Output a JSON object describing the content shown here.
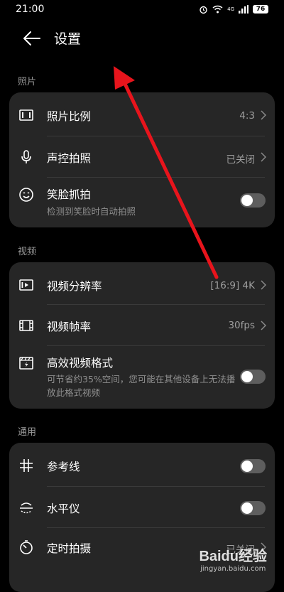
{
  "status_bar": {
    "time": "21:00",
    "battery": "76",
    "signal_tag": "4G"
  },
  "header": {
    "title": "设置"
  },
  "sections": {
    "photo": {
      "label": "照片",
      "items": [
        {
          "title": "照片比例",
          "value": "4:3"
        },
        {
          "title": "声控拍照",
          "value": "已关闭"
        },
        {
          "title": "笑脸抓拍",
          "subtitle": "检测到笑脸时自动拍照",
          "toggle_on": false
        }
      ]
    },
    "video": {
      "label": "视频",
      "items": [
        {
          "title": "视频分辨率",
          "value": "[16:9] 4K"
        },
        {
          "title": "视频帧率",
          "value": "30fps"
        },
        {
          "title": "高效视频格式",
          "subtitle": "可节省约35%空间，您可能在其他设备上无法播放此格式视频",
          "toggle_on": false
        }
      ]
    },
    "general": {
      "label": "通用",
      "items": [
        {
          "title": "参考线",
          "toggle_on": false
        },
        {
          "title": "水平仪",
          "toggle_on": false
        },
        {
          "title": "定时拍摄",
          "value": "已关闭"
        }
      ]
    }
  },
  "colors": {
    "background": "#000000",
    "card": "#262626",
    "annotation_arrow": "#e8141c",
    "toggle_off": "#5e5e5e"
  },
  "watermark": {
    "logo": "Baidu经验",
    "url": "jingyan.baidu.com"
  }
}
